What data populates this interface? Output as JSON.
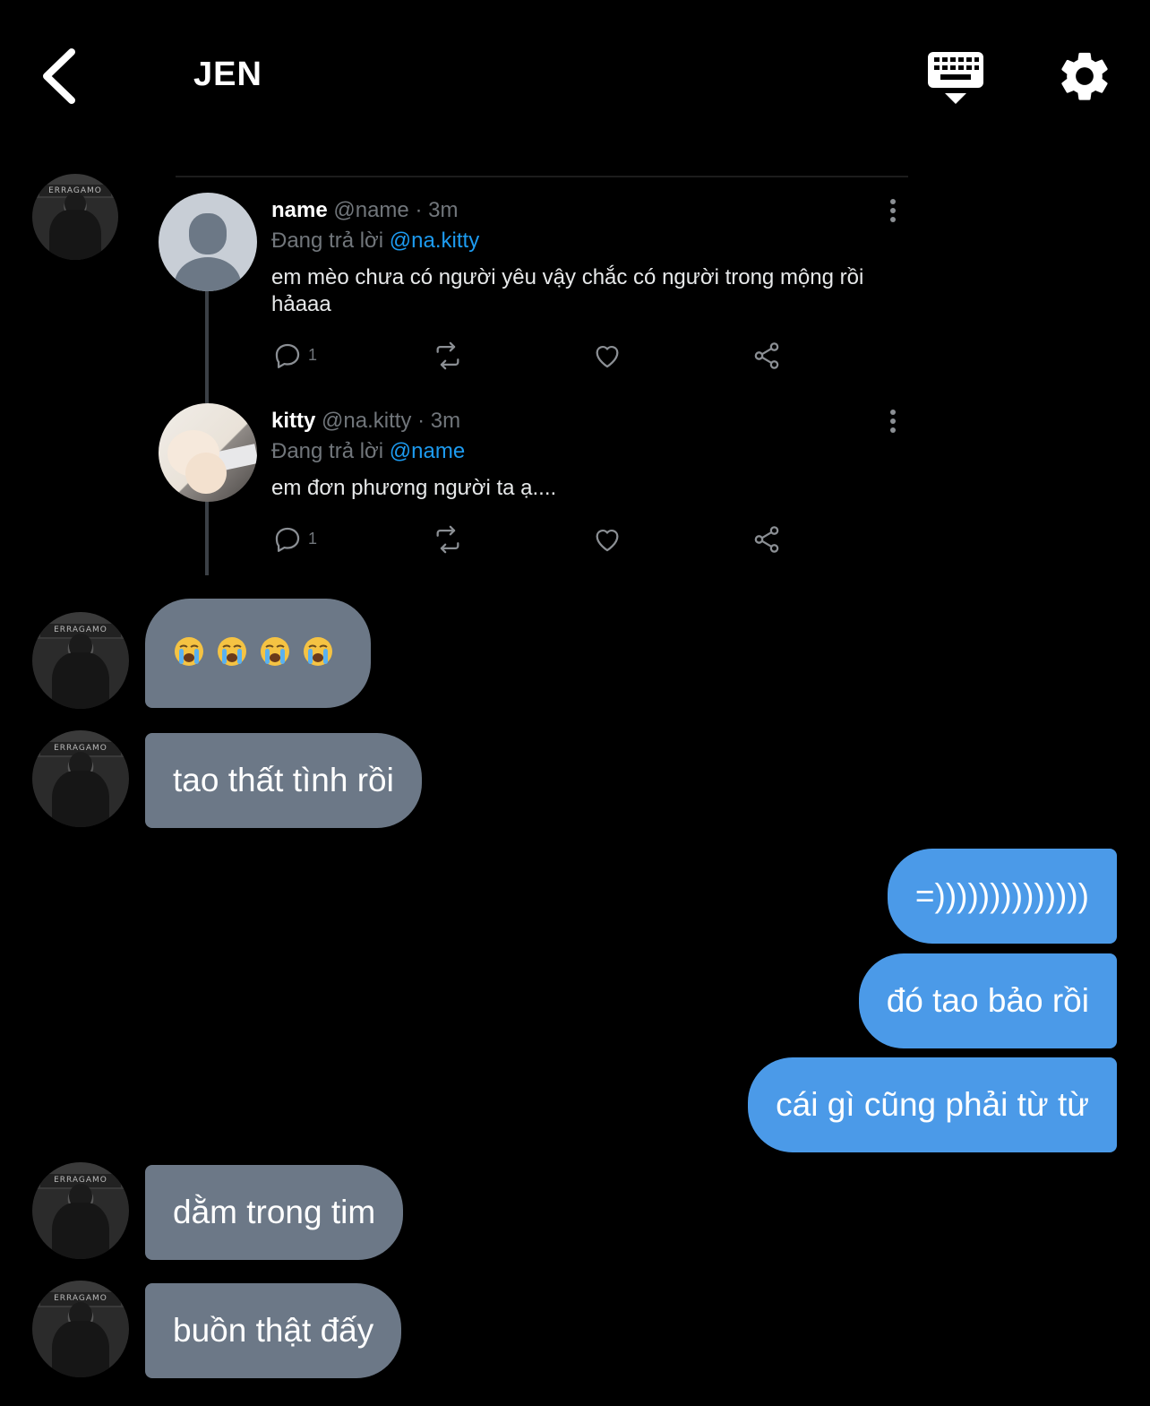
{
  "header": {
    "title": "JEN",
    "back_icon": "chevron-left-icon",
    "keyboard_icon": "keyboard-icon",
    "settings_icon": "gear-icon"
  },
  "tweet_thread": [
    {
      "display_name": "name",
      "handle": "@name",
      "time": "· 3m",
      "replying_prefix": "Đang trả lời",
      "replying_to": "@na.kitty",
      "text": "em mèo chưa có người yêu vậy chắc có người trong mộng rồi hảaaa",
      "reply_count": "1",
      "avatar": "default-avatar"
    },
    {
      "display_name": "kitty",
      "handle": "@na.kitty",
      "time": "· 3m",
      "replying_prefix": "Đang trả lời",
      "replying_to": "@name",
      "text": "em đơn phương người ta ạ....",
      "reply_count": "1",
      "avatar": "cat-avatar"
    }
  ],
  "messages": [
    {
      "direction": "incoming",
      "text": "😭 😭 😭 😭",
      "emoji": "loudly-crying-face"
    },
    {
      "direction": "incoming",
      "text": "tao thất tình rồi"
    },
    {
      "direction": "outgoing",
      "text": "=))))))))))))))"
    },
    {
      "direction": "outgoing",
      "text": "đó tao bảo rồi"
    },
    {
      "direction": "outgoing",
      "text": "cái gì cũng phải từ từ"
    },
    {
      "direction": "incoming",
      "text": "dằm trong tim"
    },
    {
      "direction": "incoming",
      "text": "buồn thật đấy"
    }
  ],
  "contact_avatar_sign": "ERRAGAMO",
  "colors": {
    "background": "#000000",
    "incoming_bubble": "#6c7887",
    "outgoing_bubble": "#4b9ae8",
    "link": "#1d9bf0"
  }
}
